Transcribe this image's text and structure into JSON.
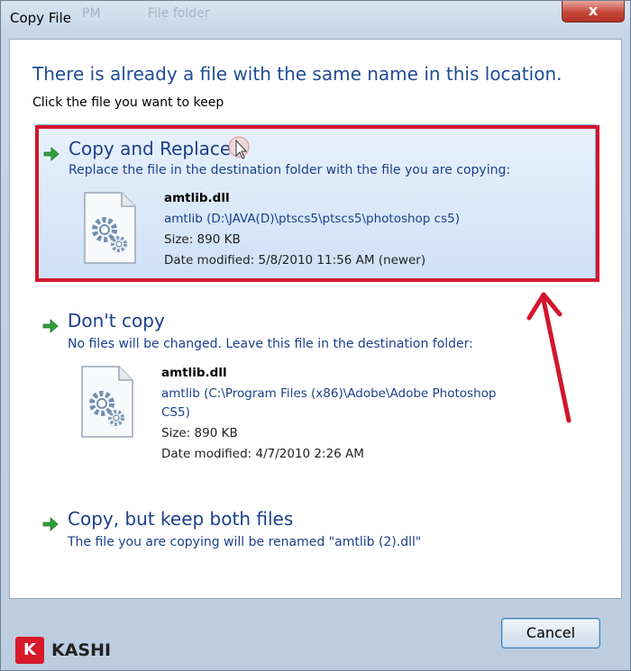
{
  "window": {
    "title": "Copy File",
    "ghost_text_left": "PM",
    "ghost_text_right": "File folder",
    "close_label": "x"
  },
  "dialog": {
    "main_instruction": "There is already a file with the same name in this location.",
    "sub_instruction": "Click the file you want to keep"
  },
  "options": [
    {
      "title": "Copy and Replace",
      "description": "Replace the file in the destination folder with the file you are copying:",
      "file": {
        "name": "amtlib.dll",
        "path": "amtlib (D:\\JAVA(D)\\ptscs5\\ptscs5\\photoshop cs5)",
        "size": "Size: 890 KB",
        "date": "Date modified: 5/8/2010 11:56 AM (newer)"
      }
    },
    {
      "title": "Don't copy",
      "description": "No files will be changed. Leave this file in the destination folder:",
      "file": {
        "name": "amtlib.dll",
        "path_line1": "amtlib (C:\\Program Files (x86)\\Adobe\\Adobe Photoshop",
        "path_line2": "CS5)",
        "size": "Size: 890 KB",
        "date": "Date modified: 4/7/2010 2:26 AM"
      }
    },
    {
      "title": "Copy, but keep both files",
      "description": "The file you are copying will be renamed \"amtlib (2).dll\""
    }
  ],
  "buttons": {
    "cancel": "Cancel"
  },
  "watermark": {
    "logo_letter": "K",
    "text": "KASHI"
  },
  "colors": {
    "instruction_blue": "#1f4d96",
    "link_blue": "#1c3f8c",
    "annotation_red": "#d1172d",
    "selection_fill": "#cfe1f7"
  },
  "icons": {
    "option_arrow": "green-arrow-icon",
    "file": "dll-gear-file-icon",
    "close": "close-icon"
  }
}
